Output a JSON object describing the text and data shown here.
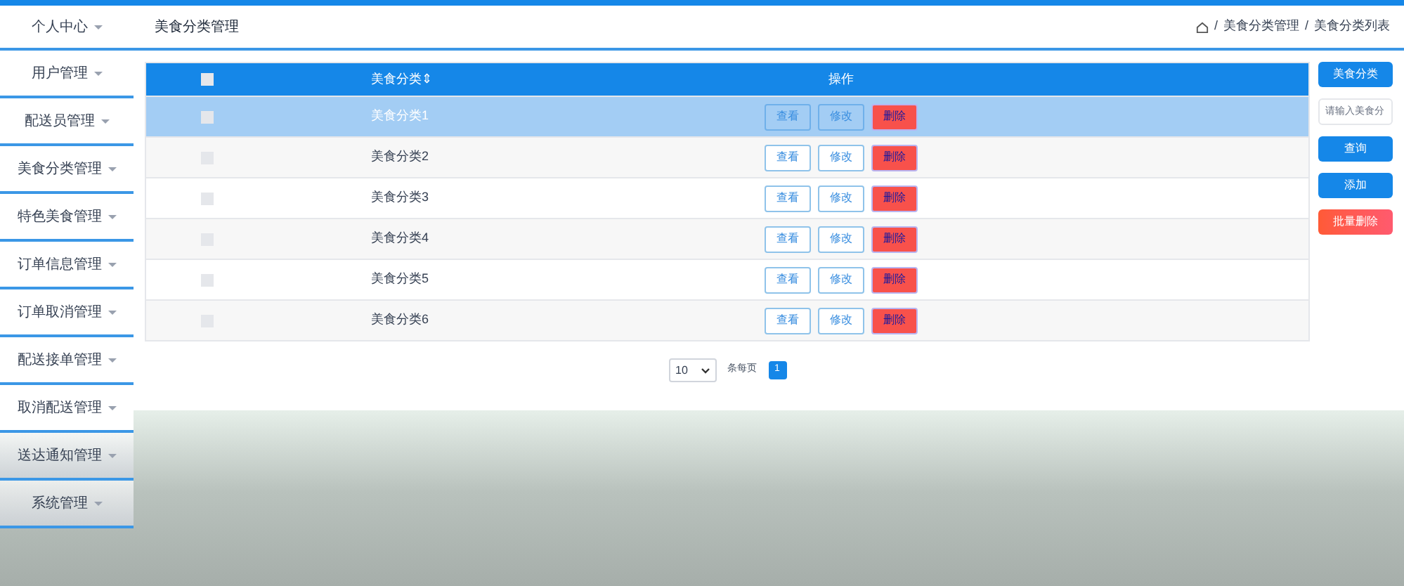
{
  "header": {
    "user_menu": "个人中心",
    "page_title": "美食分类管理",
    "breadcrumb_separator": "/",
    "breadcrumb": [
      "美食分类管理",
      "美食分类列表"
    ]
  },
  "sidebar": {
    "items": [
      {
        "label": "用户管理"
      },
      {
        "label": "配送员管理"
      },
      {
        "label": "美食分类管理"
      },
      {
        "label": "特色美食管理"
      },
      {
        "label": "订单信息管理"
      },
      {
        "label": "订单取消管理"
      },
      {
        "label": "配送接单管理"
      },
      {
        "label": "取消配送管理"
      },
      {
        "label": "送达通知管理"
      },
      {
        "label": "系统管理"
      }
    ]
  },
  "table": {
    "columns": [
      "美食分类",
      "操作"
    ],
    "sort_icon": "⇕",
    "header_checkbox": {
      "checked": false
    },
    "rows": [
      {
        "name": "美食分类1",
        "selected": true,
        "checked": false,
        "actions": [
          "查看",
          "修改",
          "删除"
        ]
      },
      {
        "name": "美食分类2",
        "selected": false,
        "checked": false,
        "actions": [
          "查看",
          "修改",
          "删除"
        ]
      },
      {
        "name": "美食分类3",
        "selected": false,
        "checked": false,
        "actions": [
          "查看",
          "修改",
          "删除"
        ]
      },
      {
        "name": "美食分类4",
        "selected": false,
        "checked": false,
        "actions": [
          "查看",
          "修改",
          "删除"
        ]
      },
      {
        "name": "美食分类5",
        "selected": false,
        "checked": false,
        "actions": [
          "查看",
          "修改",
          "删除"
        ]
      },
      {
        "name": "美食分类6",
        "selected": false,
        "checked": false,
        "actions": [
          "查看",
          "修改",
          "删除"
        ]
      }
    ]
  },
  "pagination": {
    "page_size": "10",
    "per_page_label": "条每页",
    "pages": [
      {
        "label": "1",
        "selected": true
      }
    ]
  },
  "search_panel": {
    "label": "美食分类",
    "placeholder": "请输入美食分",
    "buttons": [
      {
        "label": "查询",
        "kind": "primary"
      },
      {
        "label": "添加",
        "kind": "primary"
      },
      {
        "label": "批量删除",
        "kind": "danger"
      }
    ]
  }
}
